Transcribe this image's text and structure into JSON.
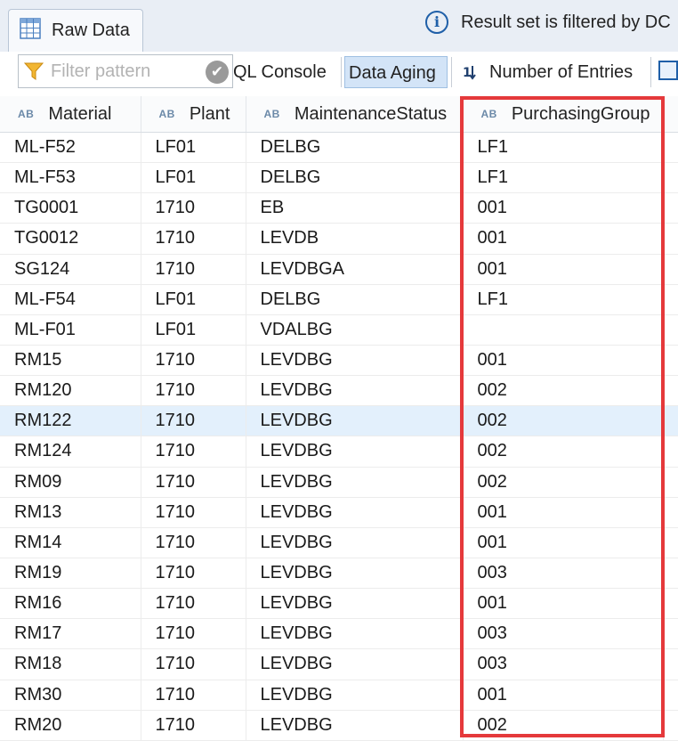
{
  "tab": {
    "label": "Raw Data",
    "icon": "table-icon"
  },
  "info": {
    "icon": "info-icon",
    "text": "Result set is filtered by DC"
  },
  "toolbar": {
    "filter_placeholder": "Filter pattern",
    "filter_value": "",
    "sql_console": "QL Console",
    "data_aging": "Data Aging",
    "number_of_entries": "Number of Entries"
  },
  "table": {
    "columns": [
      "Material",
      "Plant",
      "MaintenanceStatus",
      "PurchasingGroup"
    ],
    "column_type_badge": "AB",
    "selected_row_index": 9,
    "rows": [
      [
        "ML-F52",
        "LF01",
        "DELBG",
        "LF1"
      ],
      [
        "ML-F53",
        "LF01",
        "DELBG",
        "LF1"
      ],
      [
        "TG0001",
        "1710",
        "EB",
        "001"
      ],
      [
        "TG0012",
        "1710",
        "LEVDB",
        "001"
      ],
      [
        "SG124",
        "1710",
        "LEVDBGA",
        "001"
      ],
      [
        "ML-F54",
        "LF01",
        "DELBG",
        "LF1"
      ],
      [
        "ML-F01",
        "LF01",
        "VDALBG",
        ""
      ],
      [
        "RM15",
        "1710",
        "LEVDBG",
        "001"
      ],
      [
        "RM120",
        "1710",
        "LEVDBG",
        "002"
      ],
      [
        "RM122",
        "1710",
        "LEVDBG",
        "002"
      ],
      [
        "RM124",
        "1710",
        "LEVDBG",
        "002"
      ],
      [
        "RM09",
        "1710",
        "LEVDBG",
        "002"
      ],
      [
        "RM13",
        "1710",
        "LEVDBG",
        "001"
      ],
      [
        "RM14",
        "1710",
        "LEVDBG",
        "001"
      ],
      [
        "RM19",
        "1710",
        "LEVDBG",
        "003"
      ],
      [
        "RM16",
        "1710",
        "LEVDBG",
        "001"
      ],
      [
        "RM17",
        "1710",
        "LEVDBG",
        "003"
      ],
      [
        "RM18",
        "1710",
        "LEVDBG",
        "003"
      ],
      [
        "RM30",
        "1710",
        "LEVDBG",
        "001"
      ],
      [
        "RM20",
        "1710",
        "LEVDBG",
        "002"
      ]
    ]
  },
  "colors": {
    "accent": "#1f5fa8",
    "highlight_border": "#e5393b",
    "selected_row": "#e3f0fc"
  }
}
